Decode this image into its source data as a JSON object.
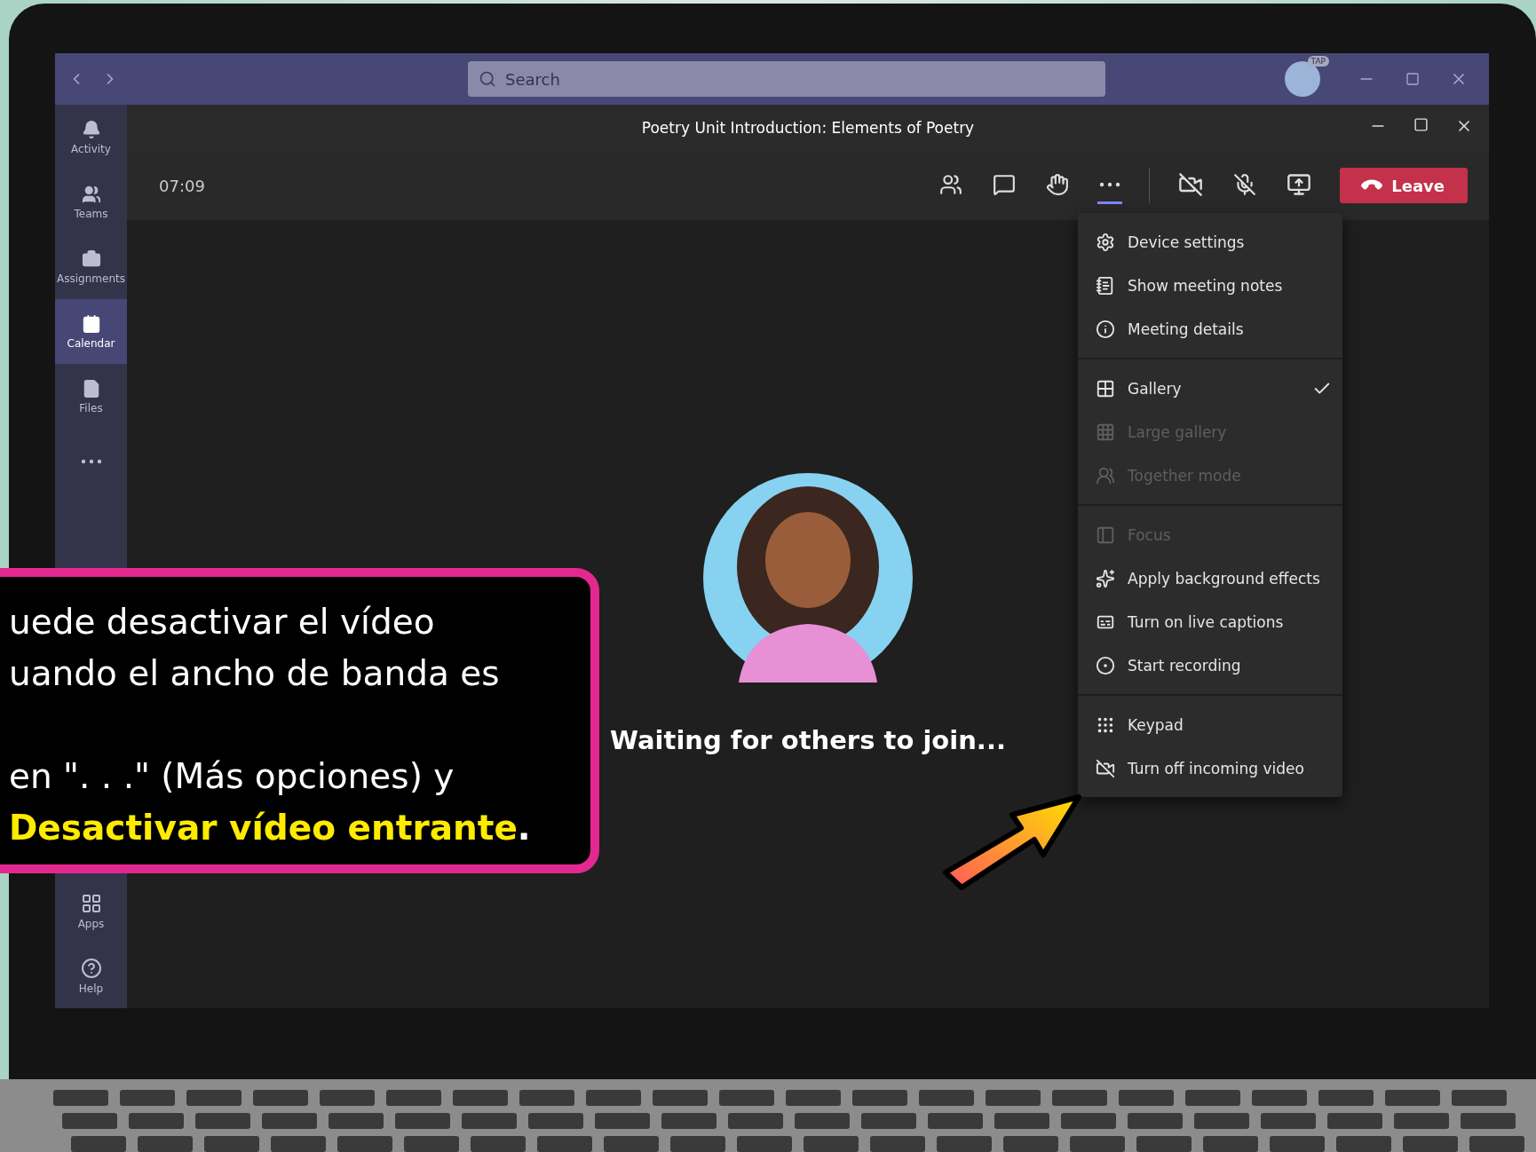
{
  "top_bar": {
    "search": {
      "placeholder": "Search"
    },
    "avatar_badge": "TAP"
  },
  "sidebar": {
    "items": [
      {
        "label": "Activity",
        "selected": false
      },
      {
        "label": "Teams",
        "selected": false
      },
      {
        "label": "Assignments",
        "selected": false
      },
      {
        "label": "Calendar",
        "selected": true
      },
      {
        "label": "Files",
        "selected": false
      }
    ],
    "bottom_items": [
      {
        "label": "Apps",
        "selected": false
      },
      {
        "label": "Help",
        "selected": false
      }
    ]
  },
  "meeting": {
    "title": "Poetry Unit Introduction: Elements of Poetry",
    "timer": "07:09",
    "more_options_active": true,
    "leave_label": "Leave",
    "waiting_text": "Waiting for others to join..."
  },
  "menu": {
    "groups": [
      [
        {
          "label": "Device settings",
          "disabled": false
        },
        {
          "label": "Show meeting notes",
          "disabled": false
        },
        {
          "label": "Meeting details",
          "disabled": false
        }
      ],
      [
        {
          "label": "Gallery",
          "disabled": false,
          "selected": true
        },
        {
          "label": "Large gallery",
          "disabled": true,
          "selected": false
        },
        {
          "label": "Together mode",
          "disabled": true,
          "selected": false
        }
      ],
      [
        {
          "label": "Focus",
          "disabled": true
        },
        {
          "label": "Apply background effects",
          "disabled": false
        },
        {
          "label": "Turn on live captions",
          "disabled": false
        },
        {
          "label": "Start recording",
          "disabled": false
        }
      ],
      [
        {
          "label": "Keypad",
          "disabled": false
        },
        {
          "label": "Turn off incoming video",
          "disabled": false
        }
      ]
    ]
  },
  "callout": {
    "lines": [
      "uede desactivar el vídeo",
      "uando el ancho de banda es",
      "en \". . .\" (Más opciones) y",
      "**Desactivar vídeo entrante**."
    ]
  }
}
